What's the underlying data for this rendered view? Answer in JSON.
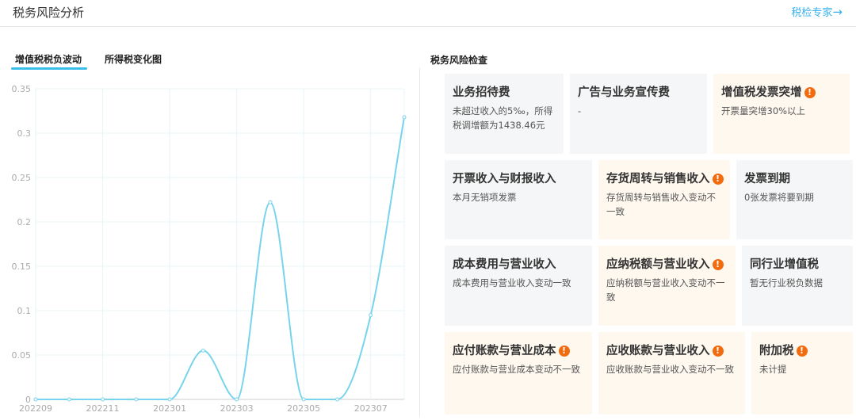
{
  "header": {
    "title": "税务风险分析",
    "expert_link": "税检专家",
    "expert_arrow": "→"
  },
  "tabs": [
    {
      "label": "增值税税负波动",
      "active": true
    },
    {
      "label": "所得税变化图",
      "active": false
    }
  ],
  "chart_data": {
    "type": "line",
    "x": [
      "202209",
      "202210",
      "202211",
      "202212",
      "202301",
      "202302",
      "202303",
      "202304",
      "202305",
      "202306",
      "202307",
      "202308"
    ],
    "x_tick_labels": [
      "202209",
      "202211",
      "202301",
      "202303",
      "202305",
      "202307"
    ],
    "series": [
      {
        "values": [
          0,
          0,
          0,
          0,
          0,
          0.055,
          0,
          0.222,
          0,
          0,
          0.095,
          0.318
        ],
        "color": "#77d4ec"
      }
    ],
    "ylim": [
      0,
      0.35
    ],
    "y_ticks": [
      "0",
      "0.05",
      "0.1",
      "0.15",
      "0.2",
      "0.25",
      "0.3",
      "0.35"
    ],
    "grid": true
  },
  "risk": {
    "title": "税务风险检查",
    "warn_symbol": "!",
    "cards": [
      {
        "title": "业务招待费",
        "desc": "未超过收入的5‰，所得税调增额为1438.46元",
        "warn": false
      },
      {
        "title": "广告与业务宣传费",
        "desc": "-",
        "warn": false
      },
      {
        "title": "增值税发票突增",
        "desc": "开票量突增30%以上",
        "warn": true
      },
      {
        "title": "开票收入与财报收入",
        "desc": "本月无销项发票",
        "warn": false
      },
      {
        "title": "存货周转与销售收入",
        "desc": "存货周转与销售收入变动不一致",
        "warn": true
      },
      {
        "title": "发票到期",
        "desc": "0张发票将要到期",
        "warn": false
      },
      {
        "title": "成本费用与营业收入",
        "desc": "成本费用与营业收入变动一致",
        "warn": false
      },
      {
        "title": "应纳税额与营业收入",
        "desc": "应纳税额与营业收入变动不一致",
        "warn": true
      },
      {
        "title": "同行业增值税",
        "desc": "暂无行业税负数据",
        "warn": false
      },
      {
        "title": "应付账款与营业成本",
        "desc": "应付账款与营业成本变动不一致",
        "warn": true
      },
      {
        "title": "应收账款与营业收入",
        "desc": "应收账款与营业收入变动不一致",
        "warn": true
      },
      {
        "title": "附加税",
        "desc": "未计提",
        "warn": true
      }
    ]
  }
}
